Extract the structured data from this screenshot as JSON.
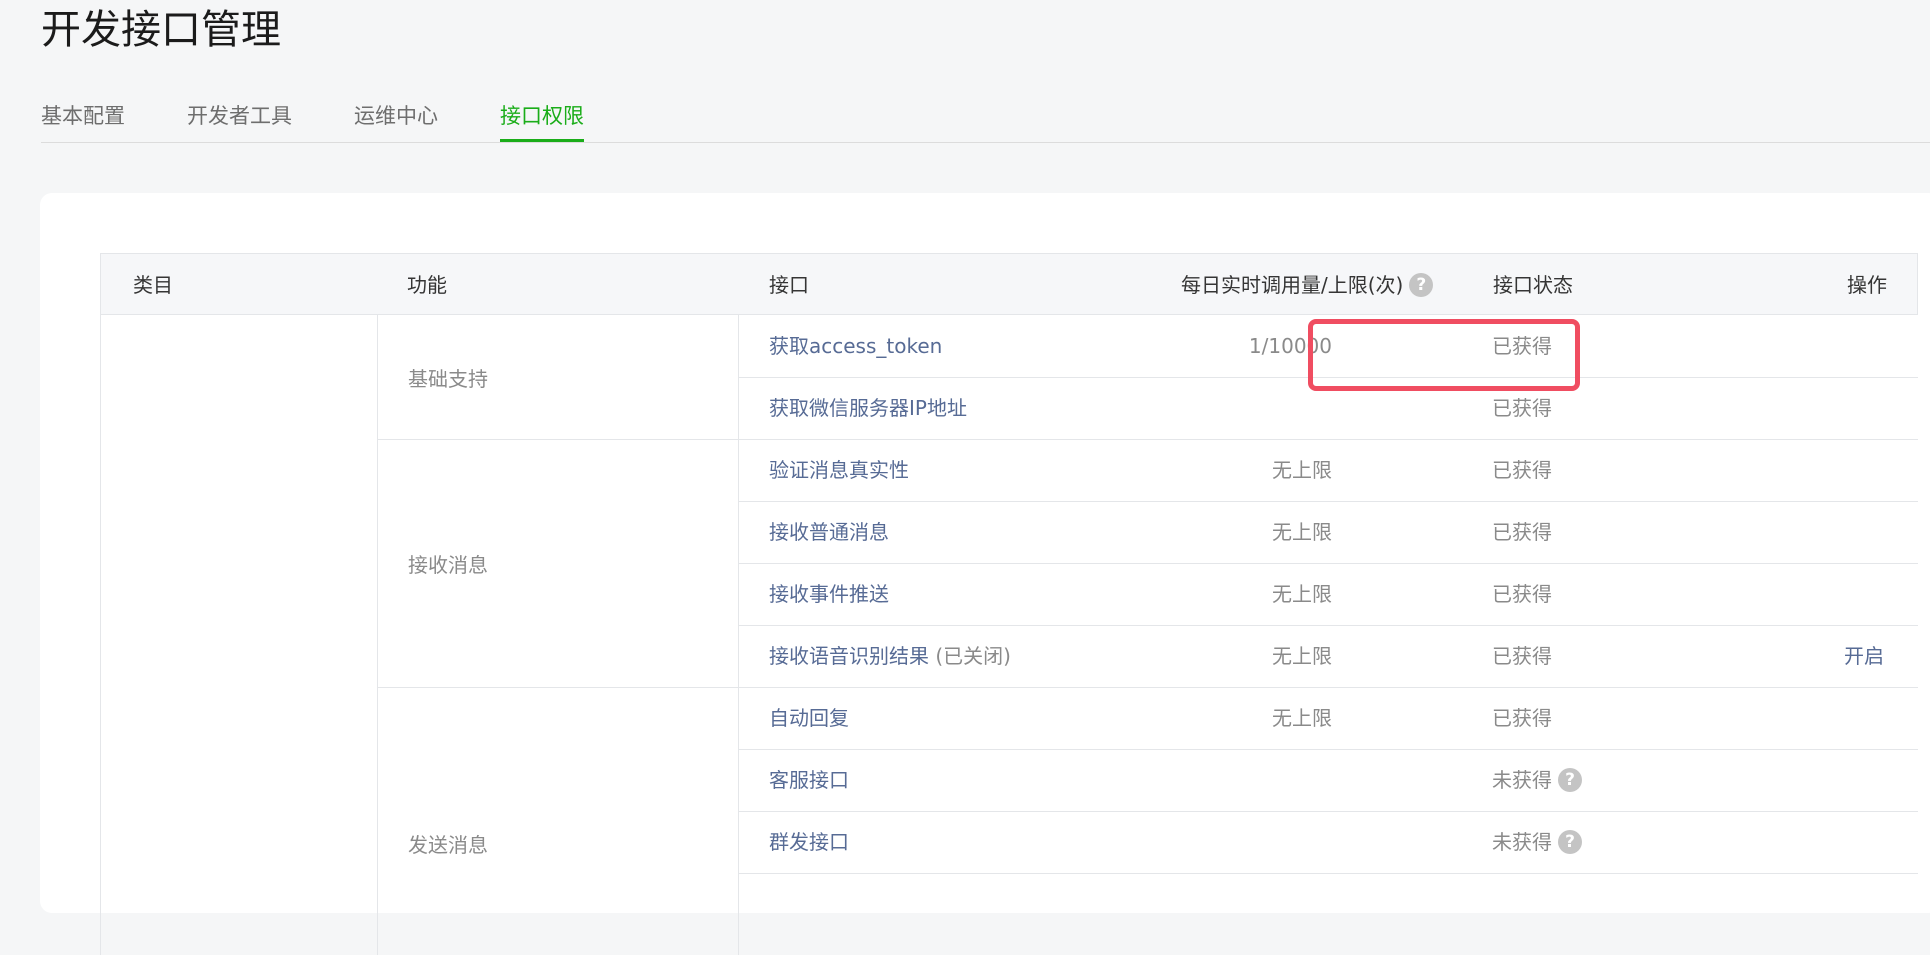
{
  "page": {
    "title": "开发接口管理"
  },
  "tabs": [
    {
      "label": "基本配置",
      "active": false
    },
    {
      "label": "开发者工具",
      "active": false
    },
    {
      "label": "运维中心",
      "active": false
    },
    {
      "label": "接口权限",
      "active": true
    }
  ],
  "table": {
    "headers": {
      "category": "类目",
      "feature": "功能",
      "interface": "接口",
      "usage": "每日实时调用量/上限(次)",
      "status": "接口状态",
      "action": "操作"
    },
    "groups": [
      {
        "feature": "基础支持"
      },
      {
        "feature": "接收消息"
      },
      {
        "feature": "发送消息"
      }
    ],
    "rows": [
      {
        "interface": "获取access_token",
        "note": "",
        "usage": "1/10000",
        "status": "已获得",
        "status_help": false,
        "action": ""
      },
      {
        "interface": "获取微信服务器IP地址",
        "note": "",
        "usage": "",
        "status": "已获得",
        "status_help": false,
        "action": ""
      },
      {
        "interface": "验证消息真实性",
        "note": "",
        "usage": "无上限",
        "status": "已获得",
        "status_help": false,
        "action": ""
      },
      {
        "interface": "接收普通消息",
        "note": "",
        "usage": "无上限",
        "status": "已获得",
        "status_help": false,
        "action": ""
      },
      {
        "interface": "接收事件推送",
        "note": "",
        "usage": "无上限",
        "status": "已获得",
        "status_help": false,
        "action": ""
      },
      {
        "interface": "接收语音识别结果",
        "note": "(已关闭)",
        "usage": "无上限",
        "status": "已获得",
        "status_help": false,
        "action": "开启"
      },
      {
        "interface": "自动回复",
        "note": "",
        "usage": "无上限",
        "status": "已获得",
        "status_help": false,
        "action": ""
      },
      {
        "interface": "客服接口",
        "note": "",
        "usage": "",
        "status": "未获得",
        "status_help": true,
        "action": ""
      },
      {
        "interface": "群发接口",
        "note": "",
        "usage": "",
        "status": "未获得",
        "status_help": true,
        "action": ""
      }
    ]
  },
  "icons": {
    "help": "question-circle-icon",
    "help_glyph": "?"
  },
  "colors": {
    "accent": "#1aad19",
    "link": "#576b95",
    "highlight": "#f04d61"
  }
}
